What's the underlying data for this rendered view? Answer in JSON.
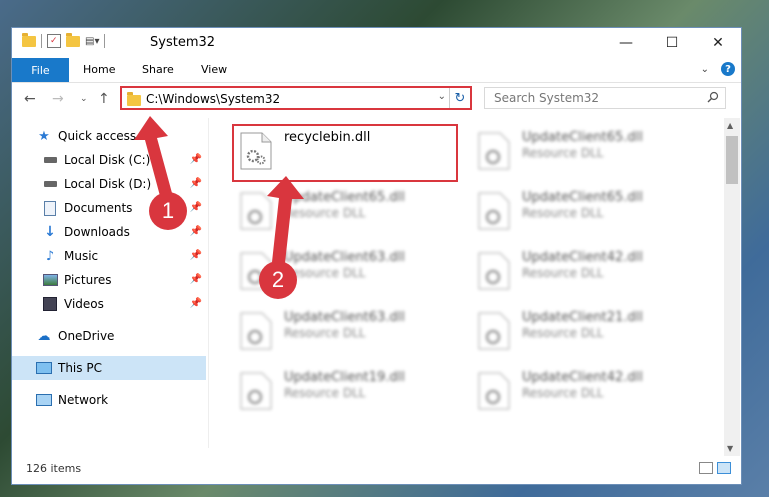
{
  "window": {
    "title": "System32",
    "controls": [
      "minimize-icon",
      "maximize-icon",
      "close-icon"
    ]
  },
  "ribbon": {
    "tabs": [
      "File",
      "Home",
      "Share",
      "View"
    ]
  },
  "address": {
    "path": "C:\\Windows\\System32"
  },
  "search": {
    "placeholder": "Search System32"
  },
  "sidebar": {
    "quick_access": "Quick access",
    "items": [
      {
        "label": "Local Disk (C:)",
        "icon": "drive-icon",
        "pinned": true
      },
      {
        "label": "Local Disk (D:)",
        "icon": "drive-icon",
        "pinned": true
      },
      {
        "label": "Documents",
        "icon": "documents-icon",
        "pinned": true
      },
      {
        "label": "Downloads",
        "icon": "downloads-icon",
        "pinned": true
      },
      {
        "label": "Music",
        "icon": "music-icon",
        "pinned": true
      },
      {
        "label": "Pictures",
        "icon": "pictures-icon",
        "pinned": true
      },
      {
        "label": "Videos",
        "icon": "videos-icon",
        "pinned": true
      }
    ],
    "onedrive": "OneDrive",
    "this_pc": "This PC",
    "network": "Network"
  },
  "files": [
    {
      "name": "recyclebin.dll",
      "type": ""
    },
    {
      "name": "UpdateClient65.dll",
      "type": "Resource DLL"
    },
    {
      "name": "UpdateClient65.dll",
      "type": "Resource DLL"
    },
    {
      "name": "UpdateClient65.dll",
      "type": "Resource DLL"
    },
    {
      "name": "UpdateClient63.dll",
      "type": "Resource DLL"
    },
    {
      "name": "UpdateClient42.dll",
      "type": "Resource DLL"
    },
    {
      "name": "UpdateClient63.dll",
      "type": "Resource DLL"
    },
    {
      "name": "UpdateClient21.dll",
      "type": "Resource DLL"
    },
    {
      "name": "UpdateClient19.dll",
      "type": "Resource DLL"
    },
    {
      "name": "UpdateClient42.dll",
      "type": "Resource DLL"
    }
  ],
  "status": {
    "count": "126 items"
  },
  "annotations": {
    "step1": "1",
    "step2": "2",
    "color": "#d9363e"
  }
}
